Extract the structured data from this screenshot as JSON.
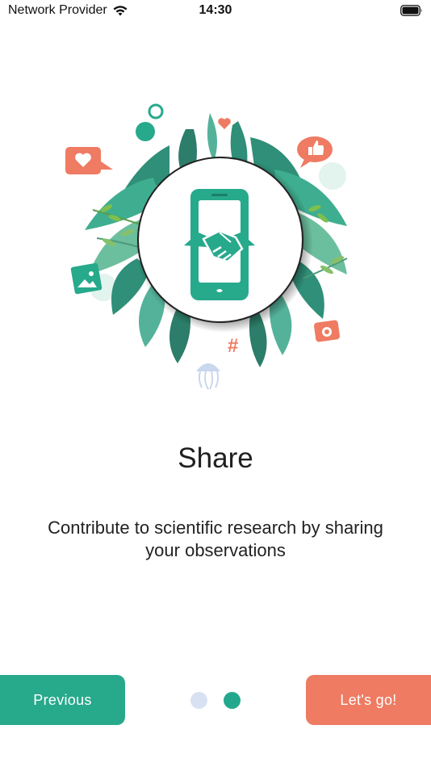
{
  "status_bar": {
    "carrier": "Network Provider",
    "time": "14:30",
    "wifi_icon": "wifi-icon",
    "battery_icon": "battery-icon"
  },
  "illustration": {
    "icon": "phone-handshake-illustration",
    "hashtag": "#"
  },
  "onboarding": {
    "title": "Share",
    "description": "Contribute to scientific research by sharing your observations"
  },
  "navigation": {
    "previous_label": "Previous",
    "next_label": "Let's go!",
    "page_count": 2,
    "current_page": 2
  },
  "colors": {
    "primary": "#27a98c",
    "accent": "#ee7b62",
    "dot_inactive": "#d7e1f2"
  }
}
